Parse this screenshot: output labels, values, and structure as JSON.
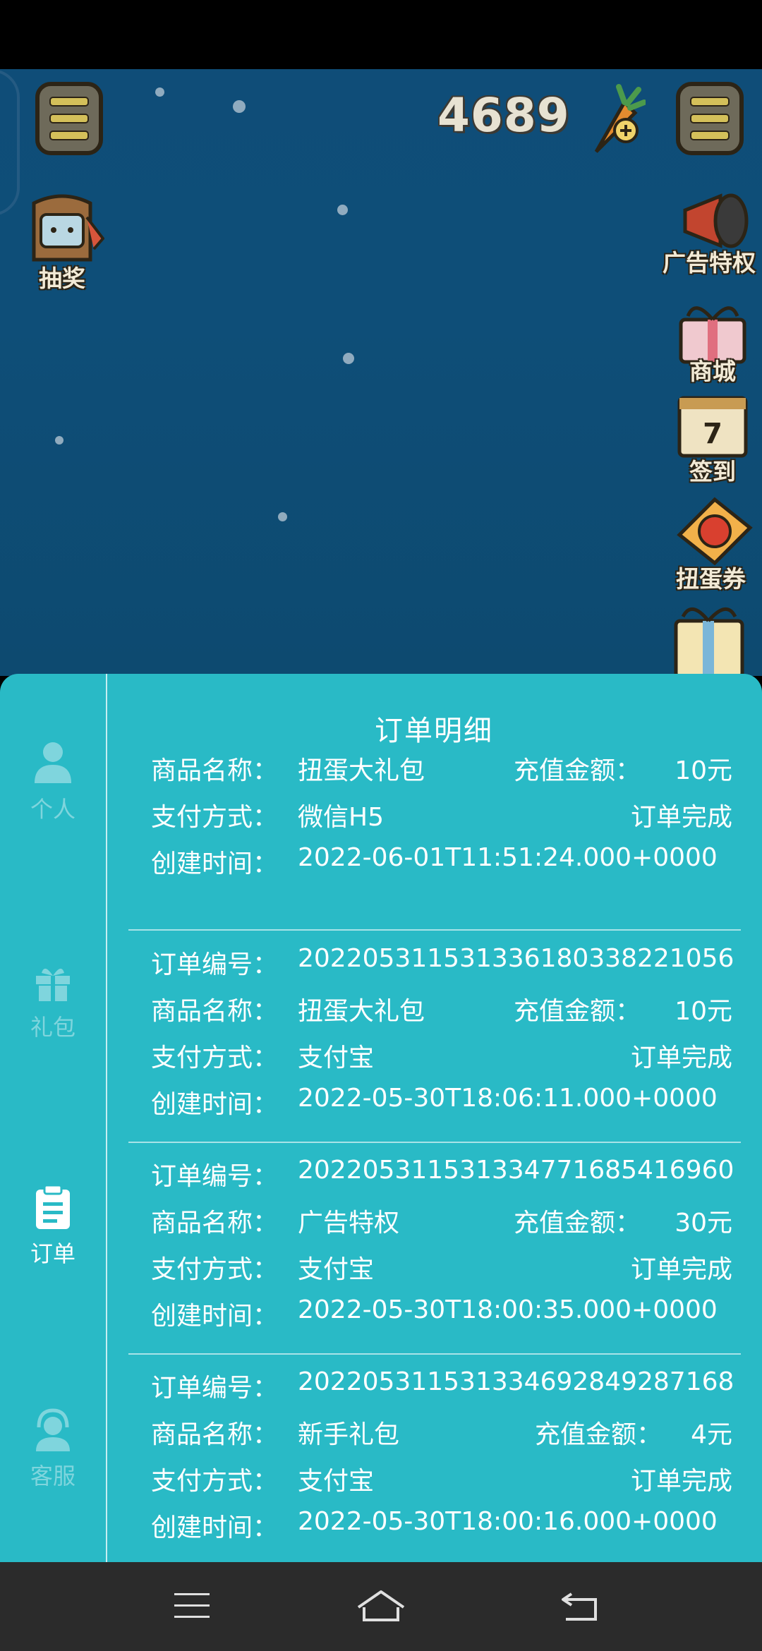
{
  "game": {
    "currency_value": "4689",
    "left_icon_label": "抽奖",
    "right_icons": [
      "广告特权",
      "商城",
      "签到",
      "扭蛋券"
    ],
    "calendar_day": "7"
  },
  "panel": {
    "title": "订单明细",
    "sidebar": [
      {
        "label": "个人",
        "icon": "person-icon",
        "active": false
      },
      {
        "label": "礼包",
        "icon": "gift-icon",
        "active": false
      },
      {
        "label": "订单",
        "icon": "clipboard-icon",
        "active": true
      },
      {
        "label": "客服",
        "icon": "headset-icon",
        "active": false
      }
    ],
    "labels": {
      "order_no": "订单编号：",
      "product": "商品名称：",
      "amount": "充值金额：",
      "payment": "支付方式：",
      "created": "创建时间："
    },
    "orders": [
      {
        "order_no": "",
        "product": "扭蛋大礼包",
        "amount": "10元",
        "payment": "微信H5",
        "status": "订单完成",
        "created": "2022-06-01T11:51:24.000+0000"
      },
      {
        "order_no": "2022053115313361803382210​56",
        "product": "扭蛋大礼包",
        "amount": "10元",
        "payment": "支付宝",
        "status": "订单完成",
        "created": "2022-05-30T18:06:11.000+0000"
      },
      {
        "order_no": "202205311531334771685416960",
        "product": "广告特权",
        "amount": "30元",
        "payment": "支付宝",
        "status": "订单完成",
        "created": "2022-05-30T18:00:35.000+0000"
      },
      {
        "order_no": "202205311531334692849287168",
        "product": "新手礼包",
        "amount": "4元",
        "payment": "支付宝",
        "status": "订单完成",
        "created": "2022-05-30T18:00:16.000+0000"
      }
    ]
  },
  "nav": {
    "icons": [
      "menu-icon",
      "home-icon",
      "back-icon"
    ]
  }
}
